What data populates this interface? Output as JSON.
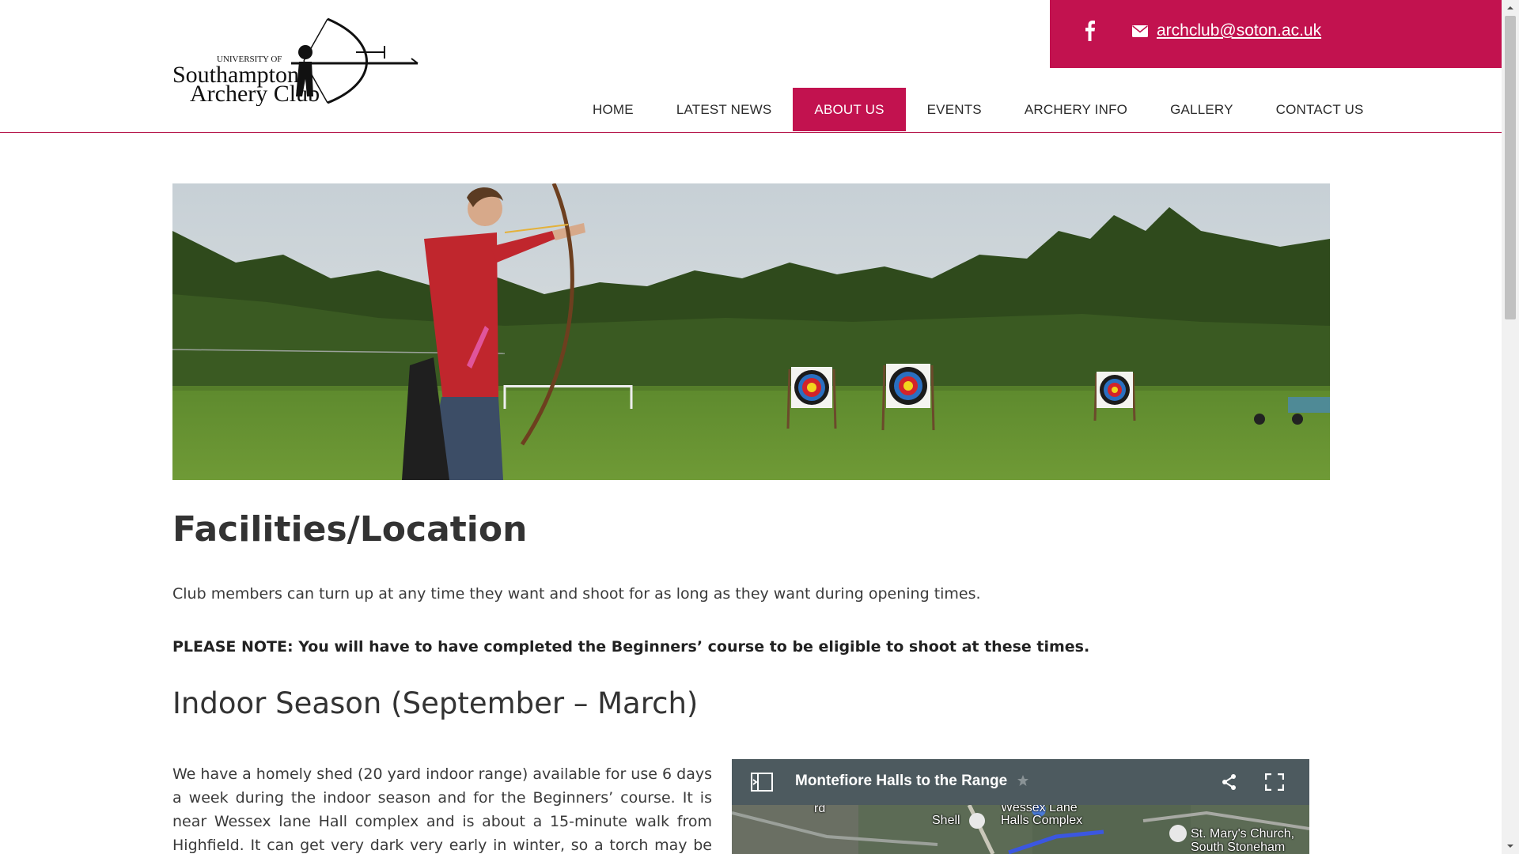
{
  "header": {
    "logo": {
      "line1": "UNIVERSITY OF",
      "line2": "Southampton",
      "line3": "Archery Club"
    },
    "contact": {
      "facebook_icon": "facebook-icon",
      "mail_icon": "envelope-icon",
      "email": "archclub@soton.ac.uk",
      "background_color": "#c2124f"
    },
    "nav": [
      {
        "label": "HOME",
        "active": false
      },
      {
        "label": "LATEST NEWS",
        "active": false
      },
      {
        "label": "ABOUT US",
        "active": true
      },
      {
        "label": "EVENTS",
        "active": false
      },
      {
        "label": "ARCHERY INFO",
        "active": false
      },
      {
        "label": "GALLERY",
        "active": false
      },
      {
        "label": "CONTACT US",
        "active": false
      }
    ]
  },
  "main": {
    "title": "Facilities/Location",
    "intro": "Club members can turn up at any time they want and shoot for as long as they want during opening times.",
    "note": "PLEASE NOTE: You will have to have completed the Beginners’ course to be eligible to shoot at these times.",
    "subheading": "Indoor Season (September – March)",
    "body": "We have a homely shed (20 yard indoor range) available for use 6 days a week during the indoor season and for the Beginners’ course. It is near Wessex lane Hall complex and is about a 15-minute walk from Highfield. It can get very dark very early in winter, so a torch may be recommended on your first visit."
  },
  "map": {
    "title": "Montefiore Halls to the Range",
    "labels": {
      "road": "rd",
      "shell": "Shell",
      "wessex_line1": "Wessex Lane",
      "wessex_line2": "Halls Complex",
      "church_line1": "St. Mary's Church,",
      "church_line2": "South Stoneham"
    }
  }
}
